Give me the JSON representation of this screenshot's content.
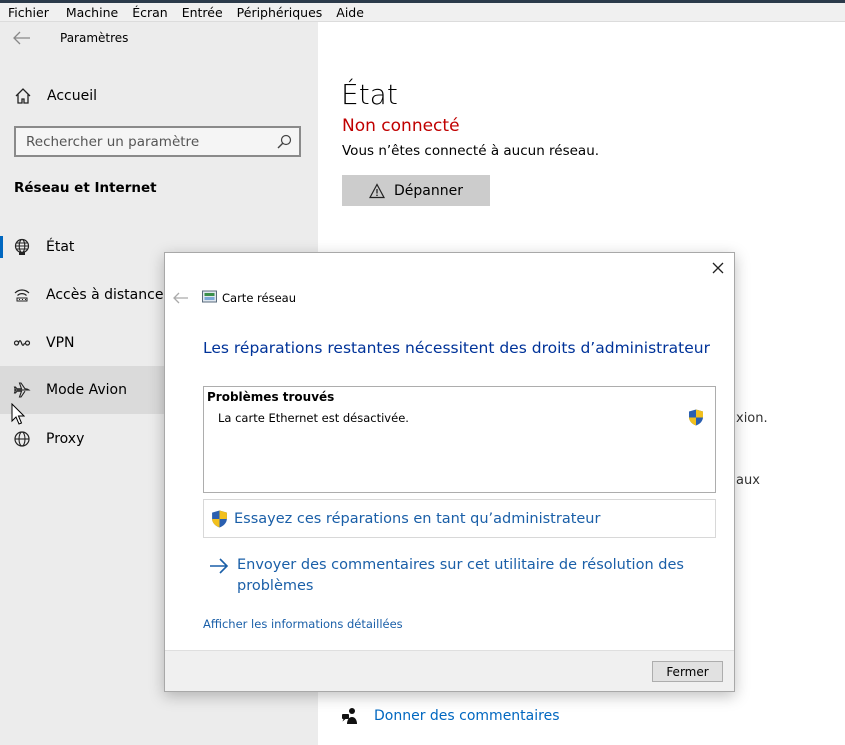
{
  "menubar": {
    "items": [
      "Fichier",
      "Machine",
      "Écran",
      "Entrée",
      "Périphériques",
      "Aide"
    ]
  },
  "sidebar": {
    "title": "Paramètres",
    "home_label": "Accueil",
    "search_placeholder": "Rechercher un paramètre",
    "section_title": "Réseau et Internet",
    "items": [
      {
        "label": "État",
        "icon": "globe-network-icon"
      },
      {
        "label": "Accès à distance",
        "icon": "dialup-icon"
      },
      {
        "label": "VPN",
        "icon": "vpn-icon"
      },
      {
        "label": "Mode Avion",
        "icon": "airplane-icon"
      },
      {
        "label": "Proxy",
        "icon": "globe-icon"
      }
    ]
  },
  "main": {
    "title": "État",
    "status": "Non connecté",
    "description": "Vous n’êtes connecté à aucun réseau.",
    "troubleshoot_label": "Dépanner",
    "partial_text_1": "xion.",
    "partial_text_2": "aux",
    "feedback_label": "Donner des commentaires"
  },
  "dialog": {
    "title": "Carte réseau",
    "heading": "Les réparations restantes nécessitent des droits d’administrateur",
    "problems_header": "Problèmes trouvés",
    "problem_item": "La carte Ethernet est désactivée.",
    "admin_repair_label": "Essayez ces réparations en tant qu’administrateur",
    "send_feedback_label": "Envoyer des commentaires sur cet utilitaire de résolution des problèmes",
    "details_link": "Afficher les informations détaillées",
    "close_label": "Fermer"
  },
  "colors": {
    "accent": "#0067c0",
    "status_error": "#c00000",
    "dialog_heading": "#003399",
    "link": "#1a5fa8"
  }
}
